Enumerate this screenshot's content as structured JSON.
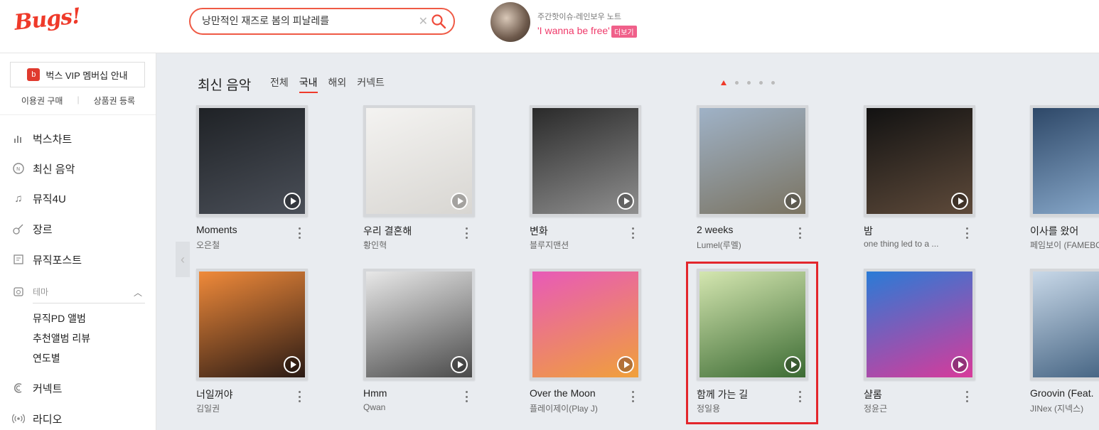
{
  "header": {
    "logo": "Bugs!",
    "search": {
      "value": "낭만적인 재즈로 봄의 피날레를",
      "clear_icon": "close-icon",
      "search_icon": "search-icon"
    },
    "promo": {
      "subtitle": "주간핫이슈-레인보우 노트",
      "title": "'I wanna be free'",
      "more_label": "더보기"
    }
  },
  "sidebar": {
    "vip_label": "벅스 VIP 멤버십 안내",
    "sub_links": [
      "이용권 구매",
      "상품권 등록"
    ],
    "nav": [
      {
        "label": "벅스차트",
        "icon": "chart-icon"
      },
      {
        "label": "최신 음악",
        "icon": "new-music-icon"
      },
      {
        "label": "뮤직4U",
        "icon": "music-note-icon"
      },
      {
        "label": "장르",
        "icon": "guitar-icon"
      },
      {
        "label": "뮤직포스트",
        "icon": "post-icon"
      },
      {
        "label": "테마",
        "icon": "theme-icon"
      },
      {
        "label": "커넥트",
        "icon": "connect-icon"
      },
      {
        "label": "라디오",
        "icon": "radio-icon"
      }
    ],
    "theme_sub": [
      "뮤직PD 앨범",
      "추천앨범 리뷰",
      "연도별"
    ]
  },
  "main": {
    "section_title": "최신 음악",
    "tabs": [
      "전체",
      "국내",
      "해외",
      "커넥트"
    ],
    "active_tab": "국내",
    "pagination_count": 5,
    "row1": [
      {
        "title": "Moments",
        "artist": "오은철",
        "colors": [
          "#1f2226",
          "#4a4f58"
        ]
      },
      {
        "title": "우리 결혼해",
        "artist": "황인혁",
        "colors": [
          "#f4f3f1",
          "#d8d6d2"
        ]
      },
      {
        "title": "변화",
        "artist": "블루지맨션",
        "colors": [
          "#2a2a2a",
          "#8f8f8f"
        ]
      },
      {
        "title": "2 weeks",
        "artist": "Lumel(루멜)",
        "colors": [
          "#9fb2c7",
          "#7a7361"
        ]
      },
      {
        "title": "밤",
        "artist": "one thing led to a ...",
        "colors": [
          "#121212",
          "#5e4a3a"
        ]
      },
      {
        "title": "이사를 왔어",
        "artist": "페임보이 (FAMEBOY)",
        "colors": [
          "#2e4868",
          "#8fb0d2"
        ]
      }
    ],
    "row2": [
      {
        "title": "너일꺼야",
        "artist": "김일권",
        "colors": [
          "#f08a3a",
          "#2a1a14"
        ]
      },
      {
        "title": "Hmm",
        "artist": "Qwan",
        "colors": [
          "#e8e8e8",
          "#4a4a4a"
        ]
      },
      {
        "title": "Over the Moon",
        "artist": "플레이제이(Play J)",
        "colors": [
          "#e85ab8",
          "#f0a03a"
        ]
      },
      {
        "title": "함께 가는 길",
        "artist": "정일용",
        "colors": [
          "#d4e6b0",
          "#3c6b33"
        ]
      },
      {
        "title": "샬롬",
        "artist": "정윤근",
        "colors": [
          "#2a7bd6",
          "#d83a9a"
        ]
      },
      {
        "title": "Groovin (Feat.",
        "artist": "JINex (지넥스)",
        "colors": [
          "#c8d8e8",
          "#3a5a7a"
        ]
      }
    ]
  }
}
